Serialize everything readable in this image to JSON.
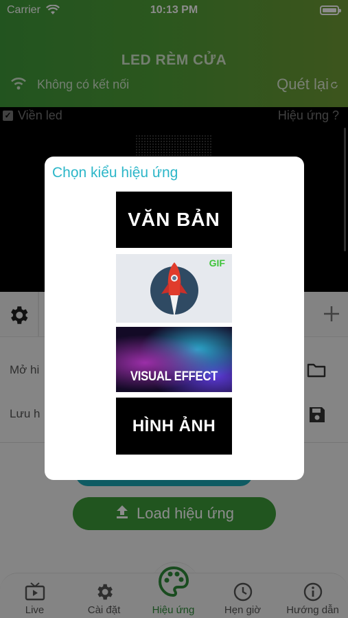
{
  "status_bar": {
    "carrier": "Carrier",
    "time": "10:13 PM"
  },
  "header": {
    "title": "LED RÈM CỬA",
    "connection_status": "Không có kết nối",
    "rescan_label": "Quét lại"
  },
  "preview": {
    "border_checkbox_label": "Viền led",
    "border_checked": true,
    "help_label": "Hiệu ứng ?"
  },
  "list": {
    "open_label": "Mở hi",
    "save_label": "Lưu h"
  },
  "load_button_label": "Load hiệu ứng",
  "tabs": [
    {
      "label": "Live",
      "icon": "tv-icon"
    },
    {
      "label": "Cài đặt",
      "icon": "gear-icon"
    },
    {
      "label": "Hiệu ứng",
      "icon": "palette-icon",
      "active": true
    },
    {
      "label": "Hẹn giờ",
      "icon": "clock-icon"
    },
    {
      "label": "Hướng dẫn",
      "icon": "info-icon"
    }
  ],
  "modal": {
    "title": "Chọn kiểu hiệu ứng",
    "options": [
      {
        "label": "VĂN BẢN"
      },
      {
        "label": "GIF"
      },
      {
        "label": "VISUAL EFFECT"
      },
      {
        "label": "HÌNH ẢNH"
      }
    ]
  },
  "colors": {
    "header_green": "#4f9e38",
    "accent_teal": "#2bb6c8",
    "active_tab_green": "#2e8b3a",
    "load_button_green": "#3c9b3a"
  }
}
